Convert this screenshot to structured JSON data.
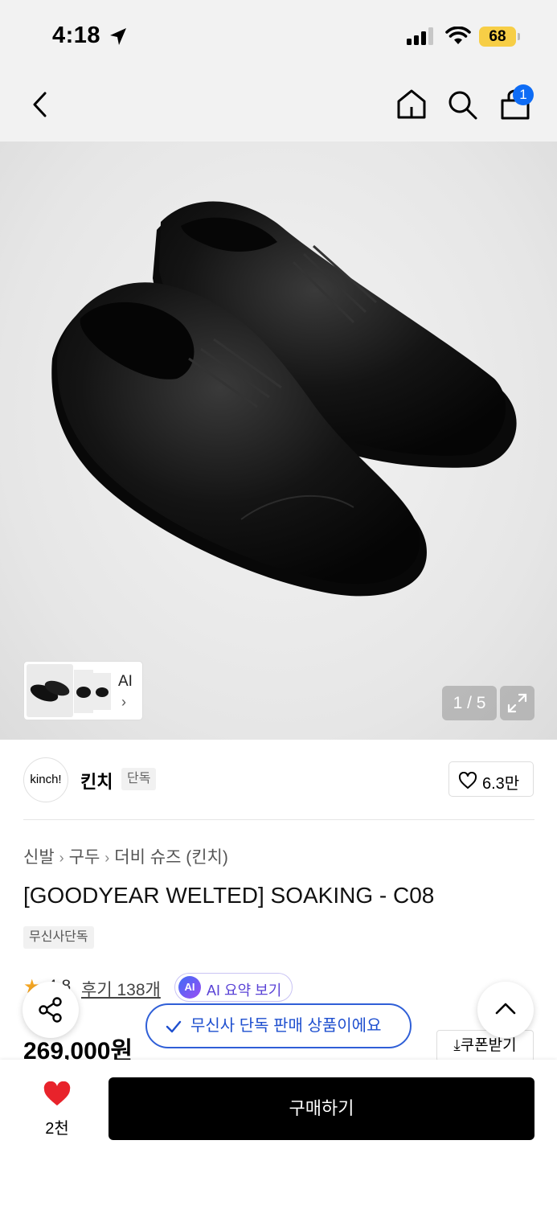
{
  "status_bar": {
    "time": "4:18",
    "battery": "68"
  },
  "nav": {
    "cart_count": "1"
  },
  "gallery": {
    "thumb_ai_label": "AI",
    "thumb_chevron": "›",
    "page_counter": "1 / 5"
  },
  "brand": {
    "logo_text": "kinch!",
    "name": "킨치",
    "tag": "단독",
    "favorite_count": "6.3만"
  },
  "breadcrumb": [
    "신발",
    "구두",
    "더비 슈즈 (킨치)"
  ],
  "breadcrumb_sep": "›",
  "product": {
    "title": "[GOODYEAR WELTED] SOAKING - C08",
    "exclusive_tag": "무신사단독",
    "rating": "4.8",
    "review_link": "후기 138개",
    "ai_badge": "AI",
    "ai_summary_label": "AI 요약 보기",
    "price": "269,000원",
    "coupon_label": "⤓쿠폰받기"
  },
  "toast": {
    "message": "무신사 단독 판매 상품이에요"
  },
  "bottom_bar": {
    "like_count": "2천",
    "buy_label": "구매하기"
  },
  "colors": {
    "accent_blue": "#0e6cf5",
    "toast_blue": "#2f5fd7",
    "like_red": "#e8232b",
    "battery_yellow": "#f7ce46"
  }
}
